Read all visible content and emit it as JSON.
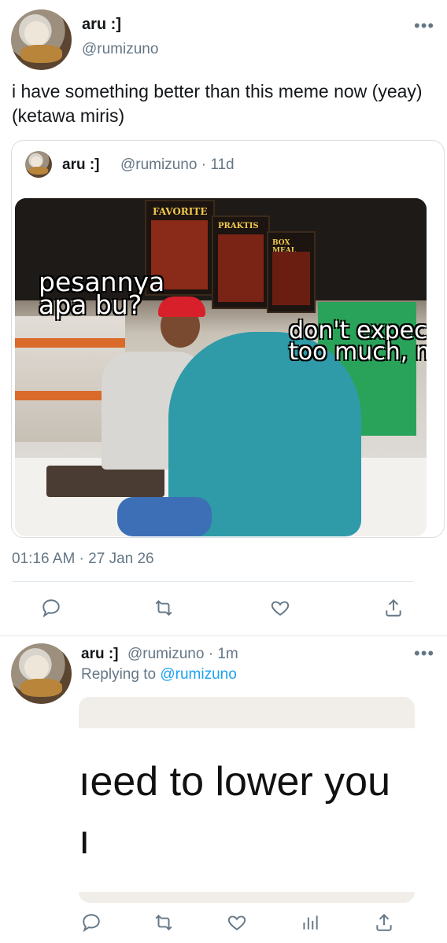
{
  "main_tweet": {
    "author_name": "aru :]",
    "author_handle": "@rumizuno",
    "more_icon": "more-horizontal-icon",
    "text": "i have something better than this meme now (yeay) (ketawa miris)",
    "quote": {
      "author_name": "aru :]",
      "author_handle_time": "@rumizuno · 11d",
      "menu_labels": [
        "FAVORITE",
        "PRAKTIS",
        "BOX MEAL"
      ],
      "caption_left_line1": "pesannya",
      "caption_left_line2": "apa bu?",
      "caption_right_line1": "don't expec",
      "caption_right_line2": "too much, m"
    },
    "timestamp": "01:16 AM · 27 Jan 26",
    "actions": [
      "reply-icon",
      "retweet-icon",
      "like-icon",
      "share-icon"
    ]
  },
  "reply_tweet": {
    "author_name": "aru :]",
    "author_handle_time": "@rumizuno · 1m",
    "replying_prefix": "Replying to",
    "replying_handle": "@rumizuno",
    "image_text_line1": "ıeed to lower you",
    "image_text_line2": "ı",
    "actions": [
      "reply-icon",
      "retweet-icon",
      "like-icon",
      "analytics-icon",
      "share-icon"
    ]
  },
  "colors": {
    "accent": "#1da1f2",
    "secondary_text": "#657786",
    "divider": "#e1e8ed"
  }
}
